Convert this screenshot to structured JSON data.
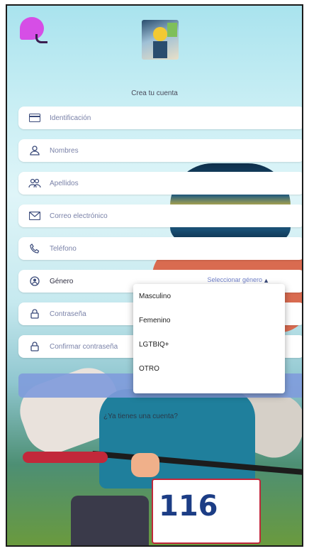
{
  "header": {
    "subtitle": "Crea tu cuenta"
  },
  "form": {
    "fields": [
      {
        "id": "identificacion",
        "icon": "id-card-icon",
        "placeholder": "Identificación"
      },
      {
        "id": "nombres",
        "icon": "person-icon",
        "placeholder": "Nombres"
      },
      {
        "id": "apellidos",
        "icon": "group-icon",
        "placeholder": "Apellidos"
      },
      {
        "id": "correo",
        "icon": "mail-icon",
        "placeholder": "Correo electrónico"
      },
      {
        "id": "telefono",
        "icon": "phone-icon",
        "placeholder": "Teléfono"
      },
      {
        "id": "genero",
        "icon": "account-circle-icon",
        "label": "Género",
        "value": "Seleccionar género"
      },
      {
        "id": "contrasena",
        "icon": "lock-icon",
        "placeholder": "Contraseña"
      },
      {
        "id": "confirmar",
        "icon": "lock-icon",
        "placeholder": "Confirmar contraseña"
      }
    ],
    "gender_options": [
      "Masculino",
      "Femenino",
      "LGTBIQ+",
      "OTRO"
    ]
  },
  "footer": {
    "login_prompt": "¿Ya tienes una cuenta?"
  },
  "background": {
    "bib_number": "116"
  },
  "colors": {
    "accent": "#d64ee6",
    "button": "#7f9bdc",
    "link": "#6f7fc7"
  }
}
